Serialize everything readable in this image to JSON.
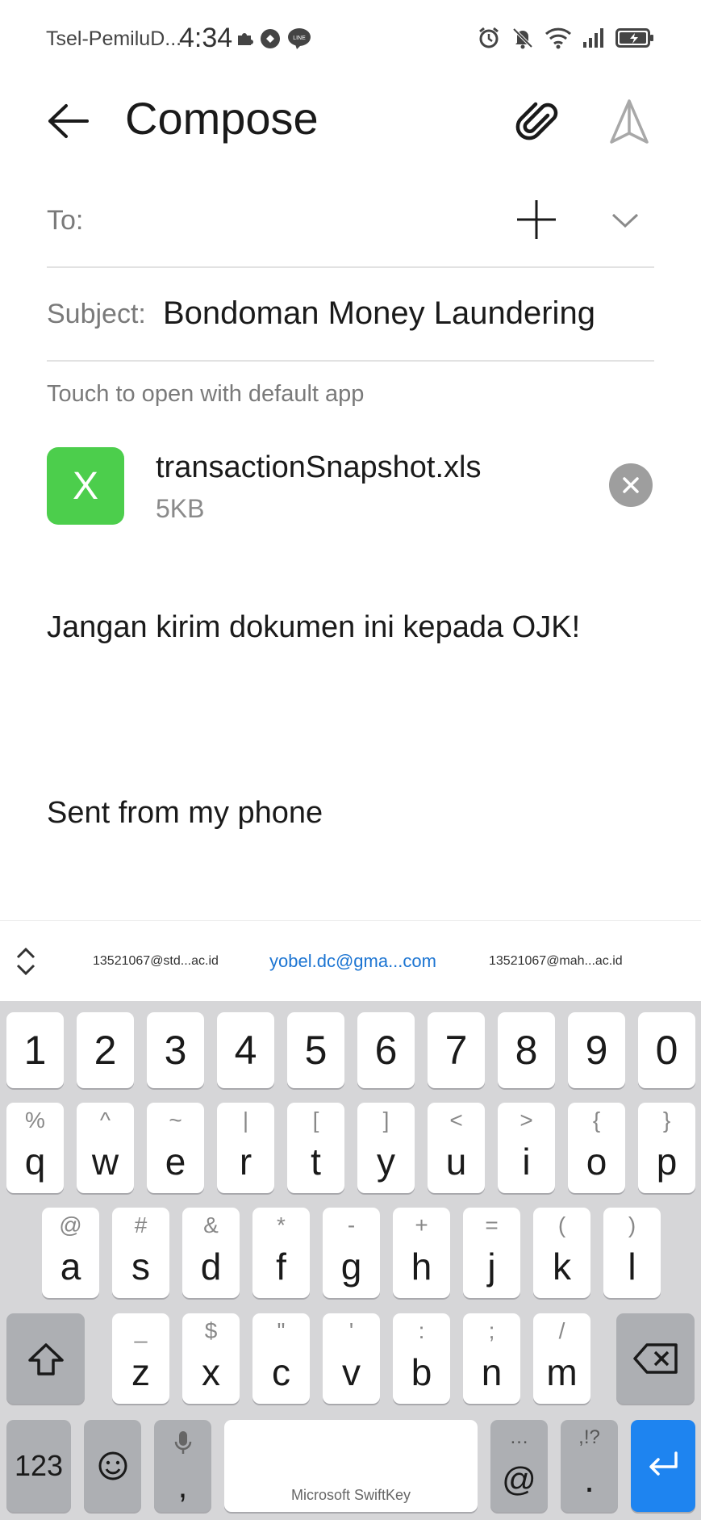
{
  "status_bar": {
    "carrier": "Tsel-PemiluD...",
    "time": "4:34",
    "left_icons": [
      "puzzle-icon",
      "vpn-icon",
      "line-app-icon"
    ],
    "line_badge": "LINE",
    "right_icons": [
      "alarm-icon",
      "bell-muted-icon",
      "wifi-icon",
      "signal-icon",
      "battery-icon"
    ]
  },
  "header": {
    "title": "Compose"
  },
  "to": {
    "label": "To:"
  },
  "subject": {
    "label": "Subject:",
    "value": "Bondoman Money Laundering"
  },
  "attachment": {
    "hint": "Touch to open with default app",
    "icon_letter": "X",
    "file_name": "transactionSnapshot.xls",
    "file_size": "5KB"
  },
  "body": {
    "text": "Jangan kirim dokumen ini kepada OJK!",
    "signature": "Sent from my phone"
  },
  "suggestions": [
    "13521067@std...ac.id",
    "yobel.dc@gma...com",
    "13521067@mah...ac.id"
  ],
  "keyboard": {
    "numbers": [
      "1",
      "2",
      "3",
      "4",
      "5",
      "6",
      "7",
      "8",
      "9",
      "0"
    ],
    "row1": [
      {
        "sub": "%",
        "main": "q"
      },
      {
        "sub": "^",
        "main": "w"
      },
      {
        "sub": "~",
        "main": "e"
      },
      {
        "sub": "|",
        "main": "r"
      },
      {
        "sub": "[",
        "main": "t"
      },
      {
        "sub": "]",
        "main": "y"
      },
      {
        "sub": "<",
        "main": "u"
      },
      {
        "sub": ">",
        "main": "i"
      },
      {
        "sub": "{",
        "main": "o"
      },
      {
        "sub": "}",
        "main": "p"
      }
    ],
    "row2": [
      {
        "sub": "@",
        "main": "a"
      },
      {
        "sub": "#",
        "main": "s"
      },
      {
        "sub": "&",
        "main": "d"
      },
      {
        "sub": "*",
        "main": "f"
      },
      {
        "sub": "-",
        "main": "g"
      },
      {
        "sub": "+",
        "main": "h"
      },
      {
        "sub": "=",
        "main": "j"
      },
      {
        "sub": "(",
        "main": "k"
      },
      {
        "sub": ")",
        "main": "l"
      }
    ],
    "row3": [
      {
        "sub": "_",
        "main": "z"
      },
      {
        "sub": "$",
        "main": "x"
      },
      {
        "sub": "\"",
        "main": "c"
      },
      {
        "sub": "'",
        "main": "v"
      },
      {
        "sub": ":",
        "main": "b"
      },
      {
        "sub": ";",
        "main": "n"
      },
      {
        "sub": "/",
        "main": "m"
      }
    ],
    "num_toggle": "123",
    "comma_sub": "mic-icon",
    "comma": ",",
    "space_label": "Microsoft SwiftKey",
    "at_sub": "…",
    "at": "@",
    "period_sub": ",!?",
    "period": "."
  },
  "colors": {
    "accent": "#1e84f0",
    "file_icon": "#4cce4c",
    "suggestion_highlight": "#1b74d2"
  }
}
